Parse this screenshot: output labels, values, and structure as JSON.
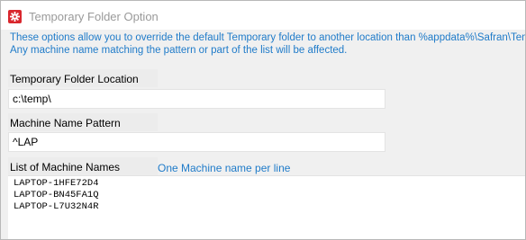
{
  "window": {
    "title": "Temporary Folder Option"
  },
  "description": {
    "line1": "These options allow you to override the default Temporary folder to another location than %appdata%\\Safran\\Temp.",
    "line2": "Any machine name matching the pattern or part of the list will be affected."
  },
  "temp_folder": {
    "label": "Temporary Folder Location",
    "value": "c:\\temp\\"
  },
  "machine_pattern": {
    "label": "Machine Name Pattern",
    "value": "^LAP"
  },
  "machine_list": {
    "label": "List of Machine Names",
    "hint": "One Machine name per line",
    "items": [
      "LAPTOP-1HFE72D4",
      "LAPTOP-BN45FA1Q",
      "LAPTOP-L7U32N4R"
    ]
  },
  "colors": {
    "accent": "#1f7bc9",
    "app_icon": "#d9272e",
    "title_text": "#9a9a9a"
  },
  "icons": {
    "app": "gear-icon"
  }
}
